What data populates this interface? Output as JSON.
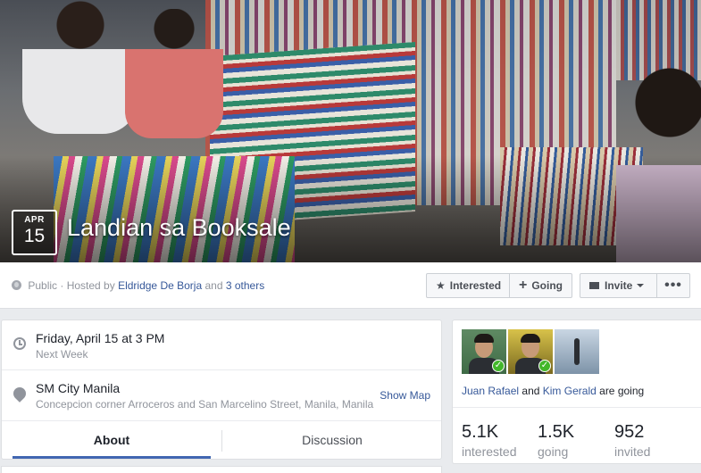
{
  "event": {
    "month": "APR",
    "day": "15",
    "title": "Landian sa Booksale"
  },
  "host": {
    "privacy": "Public",
    "hosted_prefix": "· Hosted by",
    "host_name": "Eldridge De Borja",
    "and_text": "and",
    "others": "3 others"
  },
  "actions": {
    "interested": "Interested",
    "going": "Going",
    "invite": "Invite",
    "more": "•••"
  },
  "details": {
    "date_primary": "Friday, April 15 at 3 PM",
    "date_secondary": "Next Week",
    "location_primary": "SM City Manila",
    "location_secondary": "Concepcion corner Arroceros and San Marcelino Street, Manila, Manila",
    "show_map": "Show Map"
  },
  "tabs": {
    "about": "About",
    "discussion": "Discussion"
  },
  "guests": {
    "friend1": "Juan Rafael",
    "and_text": "and",
    "friend2": "Kim Gerald",
    "going_suffix": "are going",
    "stats": [
      {
        "value": "5.1K",
        "label": "interested"
      },
      {
        "value": "1.5K",
        "label": "going"
      },
      {
        "value": "952",
        "label": "invited"
      }
    ]
  },
  "colors": {
    "link": "#365899",
    "tab_accent": "#4267b2",
    "check": "#42b72a"
  }
}
